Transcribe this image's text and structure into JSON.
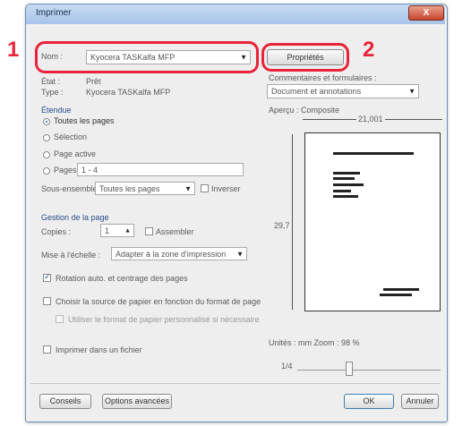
{
  "callouts": {
    "one": "1",
    "two": "2"
  },
  "window": {
    "title": "Imprimer",
    "close_symbol": "X"
  },
  "printer": {
    "name_label": "Nom :",
    "name_value": "Kyocera TASKalfa MFP",
    "properties_button": "Propriétés",
    "status_label": "État :",
    "status_value": "Prêt",
    "type_label": "Type :",
    "type_value": "Kyocera TASKalfa MFP"
  },
  "comments": {
    "label": "Commentaires et formulaires :",
    "value": "Document et annotations"
  },
  "range": {
    "heading": "Étendue",
    "all_pages": "Toutes les pages",
    "selection": "Sélection",
    "current_page": "Page active",
    "pages_label": "Pages",
    "pages_value": "1 - 4",
    "subset_label": "Sous-ensemble :",
    "subset_value": "Toutes les pages",
    "reverse_label": "Inverser"
  },
  "page_handling": {
    "heading": "Gestion de la page",
    "copies_label": "Copies :",
    "copies_value": "1",
    "collate_label": "Assembler",
    "scaling_label": "Mise à l'échelle :",
    "scaling_value": "Adapter à la zone d'impression",
    "auto_rotate_label": "Rotation auto. et centrage des pages",
    "paper_source_label": "Choisir la source de papier en fonction du format de page",
    "custom_paper_label": "Utiliser le format de papier personnalisé si nécessaire"
  },
  "print_to_file": "Imprimer dans un fichier",
  "preview": {
    "heading": "Aperçu : Composite",
    "width_value": "21,001",
    "height_value": "29,7",
    "units_zoom": "Unités : mm Zoom : 98 %",
    "page_counter": "1/4"
  },
  "footer": {
    "setup_button": "Conseils",
    "advanced_button": "Options avancées",
    "ok_button": "OK",
    "cancel_button": "Annuler"
  }
}
